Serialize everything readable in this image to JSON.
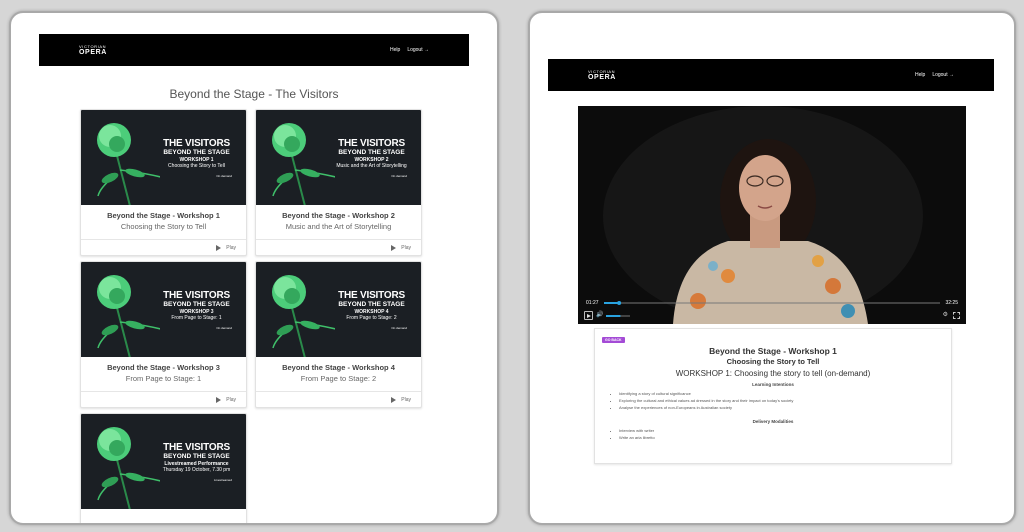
{
  "nav": {
    "logo_top": "VICTORIAN",
    "logo_bottom": "OPERA",
    "help": "Help",
    "logout": "Logout"
  },
  "listing": {
    "title": "Beyond the Stage - The Visitors",
    "cards": [
      {
        "promo": {
          "t1": "THE VISITORS",
          "t2": "BEYOND THE STAGE",
          "t3": "WORKSHOP 1",
          "t4": "Choosing the Story to Tell",
          "t5": "On demand"
        },
        "title": "Beyond the Stage - Workshop 1",
        "subtitle": "Choosing the Story to Tell",
        "play": "Play"
      },
      {
        "promo": {
          "t1": "THE VISITORS",
          "t2": "BEYOND THE STAGE",
          "t3": "WORKSHOP 2",
          "t4": "Music and the Art of Storytelling",
          "t5": "On demand"
        },
        "title": "Beyond the Stage - Workshop 2",
        "subtitle": "Music and the Art of Storytelling",
        "play": "Play"
      },
      {
        "promo": {
          "t1": "THE VISITORS",
          "t2": "BEYOND THE STAGE",
          "t3": "WORKSHOP 3",
          "t4": "From Page to Stage: 1",
          "t5": "On demand"
        },
        "title": "Beyond the Stage - Workshop 3",
        "subtitle": "From Page to Stage: 1",
        "play": "Play"
      },
      {
        "promo": {
          "t1": "THE VISITORS",
          "t2": "BEYOND THE STAGE",
          "t3": "WORKSHOP 4",
          "t4": "From Page to Stage: 2",
          "t5": "On demand"
        },
        "title": "Beyond the Stage - Workshop 4",
        "subtitle": "From Page to Stage: 2",
        "play": "Play"
      },
      {
        "promo": {
          "t1": "THE VISITORS",
          "t2": "BEYOND THE STAGE",
          "t3": "Livestreamed Performance",
          "t4": "Thursday 19 October, 7.30 pm",
          "t5": "Livestreamed"
        }
      }
    ]
  },
  "player": {
    "current_time": "01:27",
    "duration": "32:25",
    "progress_fraction": 0.045,
    "volume_fraction": 0.6
  },
  "details": {
    "go_back": "GO BACK",
    "title": "Beyond the Stage - Workshop 1",
    "subtitle": "Choosing the Story to Tell",
    "workshop": "WORKSHOP 1: Choosing the story to tell (on-demand)",
    "intentions_heading": "Learning Intentions",
    "intentions": [
      "Identifying a story of cultural significance",
      "Exploring the cultural and ethical values ad dressed in the story and their impact on today's society",
      "Analyse the experiences of non-Europeans in Australian society"
    ],
    "modalities_heading": "Delivery Modalities",
    "modalities": [
      "Interview with writer",
      "Write an aria libretto"
    ]
  },
  "colors": {
    "nav_bg": "#000000",
    "go_back": "#a44bd6",
    "progress": "#29a3e0",
    "thumb_bg": "#1b1f24"
  }
}
